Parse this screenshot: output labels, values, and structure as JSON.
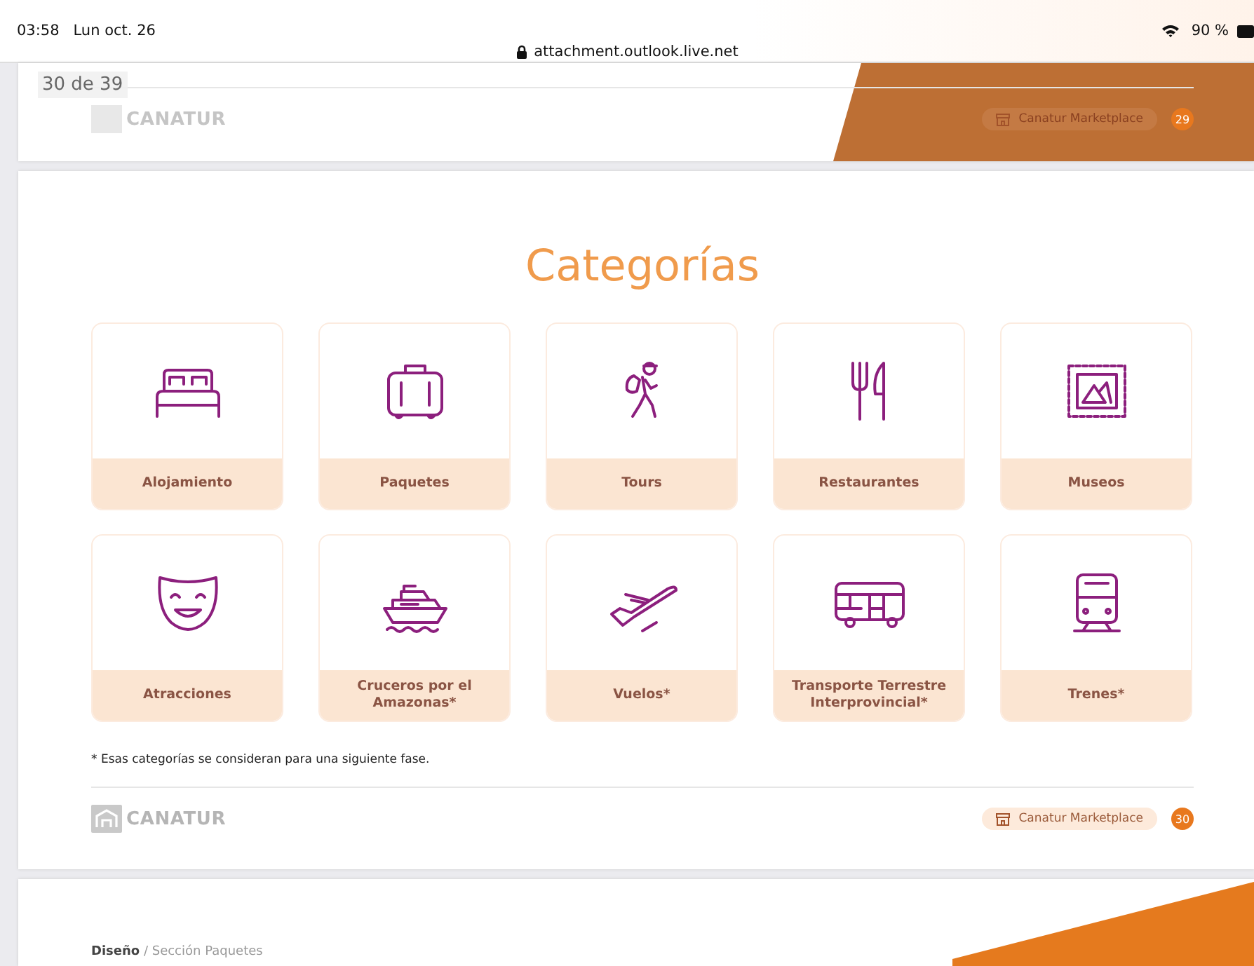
{
  "status_bar": {
    "time": "03:58",
    "date": "Lun oct. 26",
    "url": "attachment.outlook.live.net",
    "battery": "90 %"
  },
  "page_indicator": "30 de 39",
  "previous_page": {
    "logo": "CANATUR",
    "marketplace": "Canatur Marketplace",
    "page_number": "29"
  },
  "current_page": {
    "title": "Categorías",
    "categories": [
      {
        "label": "Alojamiento"
      },
      {
        "label": "Paquetes"
      },
      {
        "label": "Tours"
      },
      {
        "label": "Restaurantes"
      },
      {
        "label": "Museos"
      },
      {
        "label": "Atracciones"
      },
      {
        "label": "Cruceros por el Amazonas*"
      },
      {
        "label": "Vuelos*"
      },
      {
        "label": "Transporte Terrestre Interprovincial*"
      },
      {
        "label": "Trenes*"
      }
    ],
    "footnote": "* Esas categorías se consideran para una siguiente fase.",
    "footer": {
      "logo": "CANATUR",
      "marketplace": "Canatur Marketplace",
      "page_number": "30"
    }
  },
  "next_page": {
    "breadcrumb": "**Diseño** / Sección Paquetes"
  }
}
